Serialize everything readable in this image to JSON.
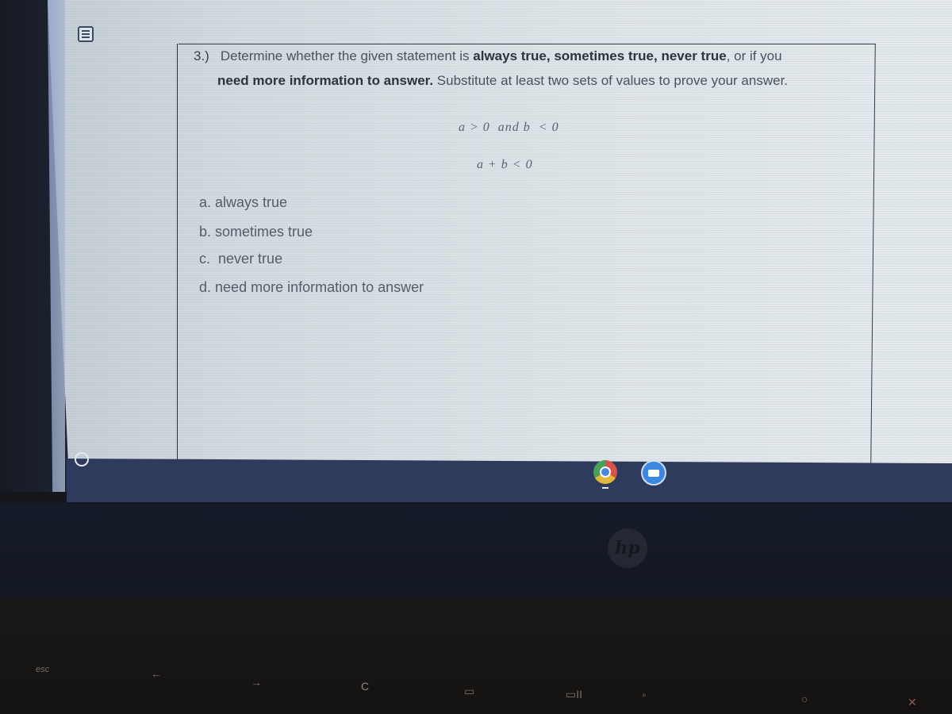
{
  "question": {
    "number": "3.)",
    "intro": "Determine whether the given statement is ",
    "opt_always": "always true",
    "sep1": ", ",
    "opt_sometimes": "sometimes true",
    "sep2": ", ",
    "opt_never": "never true",
    "mid": ", or if you",
    "opt_more_info": "need more information to answer.",
    "instruction": " Substitute at least two sets of values to prove your answer."
  },
  "statement": {
    "given": "a > 0  and b  < 0",
    "claim": "a + b < 0"
  },
  "choices": [
    {
      "letter": "a.",
      "text": "always true"
    },
    {
      "letter": "b.",
      "text": "sometimes true"
    },
    {
      "letter": "c.",
      "text": "never true"
    },
    {
      "letter": "d.",
      "text": "need more information to answer"
    }
  ],
  "shelf": {
    "apps": [
      {
        "name": "Chrome",
        "icon": "chrome-icon",
        "active": true
      },
      {
        "name": "Zoom",
        "icon": "zoom-video-icon",
        "active": false
      }
    ]
  },
  "brand": "hp",
  "keyboard": {
    "keys": [
      "esc",
      "←",
      "→",
      "C",
      "▭",
      "▭II",
      "∘",
      "○",
      "✕"
    ]
  }
}
